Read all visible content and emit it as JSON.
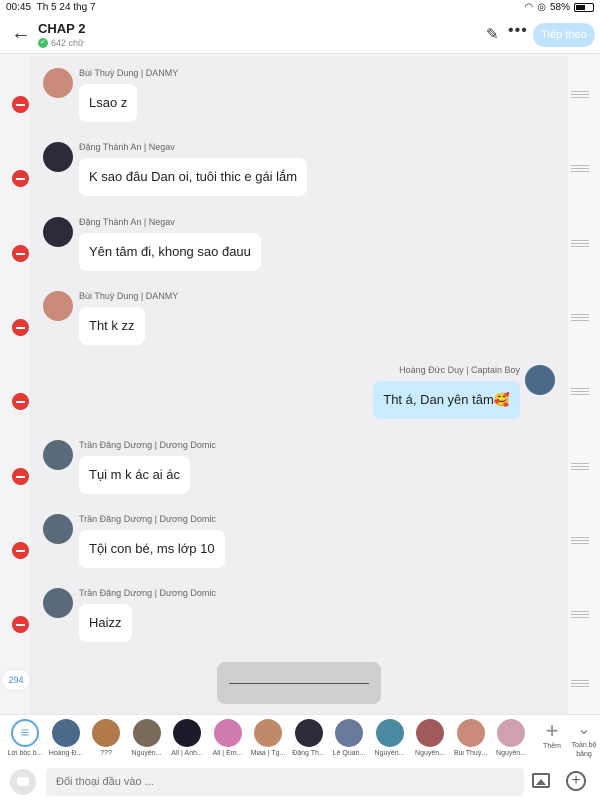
{
  "status_bar": {
    "time": "00:45",
    "date": "Th 5 24 thg 7",
    "battery": "58%",
    "battery_level": 0.58
  },
  "header": {
    "title": "CHAP 2",
    "word_count": "642 chữ",
    "next_label": "Tiếp theo"
  },
  "messages": [
    {
      "side": "left",
      "sender": "Bùi Thuỳ Dung | DANMY",
      "text": "Lsao z",
      "avatar_color": "#c98a7a"
    },
    {
      "side": "left",
      "sender": "Đặng Thành An | Negav",
      "text": "K sao đâu Dan oi, tuôi thic e gái lắm",
      "avatar_color": "#2b2b3a"
    },
    {
      "side": "left",
      "sender": "Đặng Thành An | Negav",
      "text": "Yên tâm đi, khong sao đauu",
      "avatar_color": "#2b2b3a"
    },
    {
      "side": "left",
      "sender": "Bùi Thuỳ Dung | DANMY",
      "text": "Tht k zz",
      "avatar_color": "#c98a7a"
    },
    {
      "side": "right",
      "sender": "Hoàng Đức Duy | Captain Boy",
      "text": "Tht á, Dan yên tâm🥰",
      "avatar_color": "#4a6a8a"
    },
    {
      "side": "left",
      "sender": "Trần Đăng Dương | Dương Domic",
      "text": "Tụi m k ác ai ác",
      "avatar_color": "#5a6a7a"
    },
    {
      "side": "left",
      "sender": "Trần Đăng Dương | Dương Domic",
      "text": "Tội con bé, ms lớp 10",
      "avatar_color": "#5a6a7a"
    },
    {
      "side": "left",
      "sender": "Trần Đăng Dương | Dương Domic",
      "text": "Haizz",
      "avatar_color": "#5a6a7a"
    }
  ],
  "message_count_badge": "294",
  "characters": [
    {
      "label": "Lời bốc b...",
      "color": "#ffffff"
    },
    {
      "label": "Hoàng Đ...",
      "color": "#4a6a8a"
    },
    {
      "label": "???",
      "color": "#b07a4a"
    },
    {
      "label": "Nguyễn...",
      "color": "#7a6a5a"
    },
    {
      "label": "All | Anh...",
      "color": "#1a1a2a"
    },
    {
      "label": "All | Em...",
      "color": "#d07ab0"
    },
    {
      "label": "Miaa | Tg...",
      "color": "#c08a6a"
    },
    {
      "label": "Đặng Th...",
      "color": "#2b2b3a"
    },
    {
      "label": "Lê Quan...",
      "color": "#6a7a9a"
    },
    {
      "label": "Nguyễn...",
      "color": "#4a8aa0"
    },
    {
      "label": "Nguyễn...",
      "color": "#a05a5a"
    },
    {
      "label": "Bùi Thuỳ...",
      "color": "#c98a7a"
    },
    {
      "label": "Nguyễn...",
      "color": "#d0a0b0"
    }
  ],
  "add_label": "Thêm",
  "all_label": "Toàn bộ băng",
  "input": {
    "placeholder": "Đối thoại đầu vào ..."
  }
}
